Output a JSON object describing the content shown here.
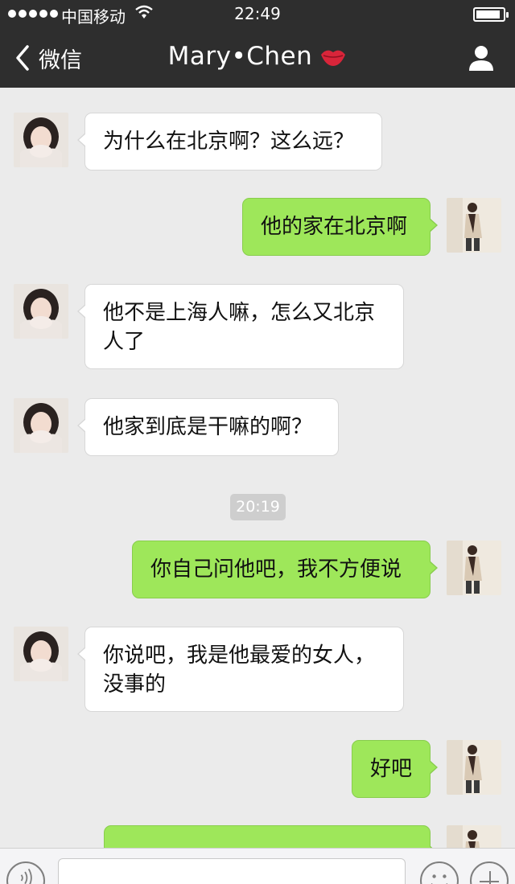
{
  "status_bar": {
    "carrier": "中国移动",
    "time": "22:49",
    "battery_level": 0.9
  },
  "nav": {
    "back_label": "微信",
    "title": "Mary•Chen"
  },
  "messages": [
    {
      "sender": "contact",
      "text": "为什么在北京啊？这么远？"
    },
    {
      "sender": "me",
      "text": "他的家在北京啊"
    },
    {
      "sender": "contact",
      "text": "他不是上海人嘛，怎么又北京人了"
    },
    {
      "sender": "contact",
      "text": "他家到底是干嘛的啊？"
    },
    {
      "sender": "me",
      "text": "你自己问他吧，我不方便说"
    },
    {
      "sender": "contact",
      "text": "你说吧，我是他最爱的女人，没事的"
    },
    {
      "sender": "me",
      "text": "好吧"
    },
    {
      "sender": "me",
      "text": ""
    }
  ],
  "timestamp": "20:19",
  "colors": {
    "nav_bg": "#2e2e2e",
    "chat_bg": "#ebebeb",
    "outgoing_bubble": "#9ee75a",
    "incoming_bubble": "#ffffff",
    "lips": "#d8253a"
  },
  "icons": {
    "back": "chevron-left-icon",
    "title_emoji": "lips-icon",
    "profile": "person-icon",
    "voice": "voice-icon",
    "emoji": "emoji-icon",
    "plus": "plus-icon"
  }
}
